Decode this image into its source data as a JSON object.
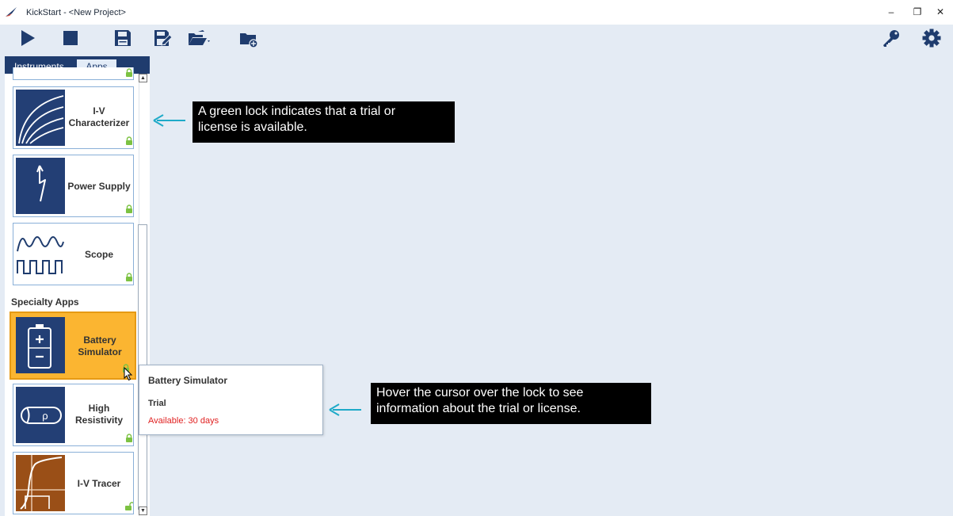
{
  "window": {
    "title": "KickStart - <New Project>",
    "controls": {
      "minimize": "–",
      "restore": "❐",
      "close": "✕"
    }
  },
  "toolbar": {
    "left_icons": [
      "play-icon",
      "stop-icon",
      "save-icon",
      "save-as-icon",
      "open-folder-icon",
      "new-folder-icon"
    ],
    "right_icons": [
      "key-icon",
      "gear-icon"
    ]
  },
  "panel": {
    "tabs": [
      {
        "label": "Instruments",
        "active": false
      },
      {
        "label": "Apps",
        "active": true
      }
    ],
    "apps": [
      {
        "label": "I-V Characterizer",
        "lines": [
          "I-V",
          "Characterizer"
        ],
        "icon": "iv-curve-icon",
        "lock": "locked-green"
      },
      {
        "label": "Power Supply",
        "lines": [
          "Power Supply"
        ],
        "icon": "power-supply-icon",
        "lock": "locked-green"
      },
      {
        "label": "Scope",
        "lines": [
          "Scope"
        ],
        "icon": "scope-icon",
        "lock": "locked-green"
      }
    ],
    "specialty_heading": "Specialty Apps",
    "specialty_apps": [
      {
        "label": "Battery Simulator",
        "lines": [
          "Battery",
          "Simulator"
        ],
        "icon": "battery-icon",
        "lock": "locked-green",
        "selected": true
      },
      {
        "label": "High Resistivity",
        "lines": [
          "High",
          "Resistivity"
        ],
        "icon": "resistivity-icon",
        "lock": "locked-green"
      },
      {
        "label": "I-V Tracer",
        "lines": [
          "I-V Tracer"
        ],
        "icon": "iv-tracer-icon",
        "lock": "unlocked-green"
      }
    ]
  },
  "tooltip": {
    "title": "Battery Simulator",
    "status": "Trial",
    "availability": "Available: 30 days"
  },
  "callouts": [
    {
      "lines": [
        "A green lock indicates that a trial or",
        "license is available."
      ]
    },
    {
      "lines": [
        "Hover the cursor over the lock to see",
        "information about the trial or license."
      ]
    }
  ],
  "colors": {
    "workspace": "#e4ebf4",
    "navy": "#1f3c6e",
    "selected": "#fbb531",
    "lock_green": "#7cc242",
    "callout_arrow": "#1eaac8",
    "availability_red": "#e02020"
  }
}
